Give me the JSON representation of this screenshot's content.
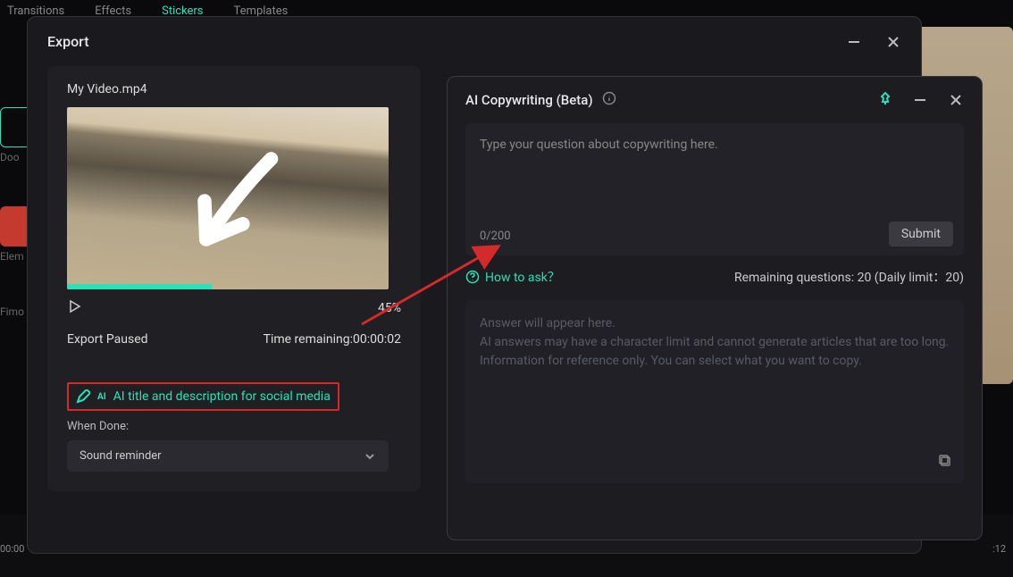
{
  "bg_tabs": {
    "transitions": "Transitions",
    "effects": "Effects",
    "stickers": "Stickers",
    "templates": "Templates"
  },
  "bg_left": {
    "doo": "Doo",
    "elem": "Elem",
    "fimo": "Fimo"
  },
  "export": {
    "title": "Export",
    "filename": "My Video.mp4",
    "percent": "45%",
    "status": "Export Paused",
    "time_remaining_label": "Time remaining:",
    "time_remaining_value": "00:00:02",
    "ai_link": "AI title and description for social media",
    "ai_icon_label": "AI",
    "when_done": "When Done:",
    "select_value": "Sound reminder"
  },
  "ai_panel": {
    "title": "AI Copywriting (Beta)",
    "placeholder": "Type your question about copywriting here.",
    "counter": "0/200",
    "submit": "Submit",
    "how_to_ask": "How to ask？",
    "remaining": "Remaining questions: 20 (Daily limit：20)",
    "answer_l1": "Answer will appear here.",
    "answer_l2": "AI answers may have a character limit and cannot generate articles that are too long.",
    "answer_l3": "Information for reference only. You can select what you want to copy."
  },
  "timeline": {
    "left_time": "00:00",
    "right_time": ":12"
  }
}
